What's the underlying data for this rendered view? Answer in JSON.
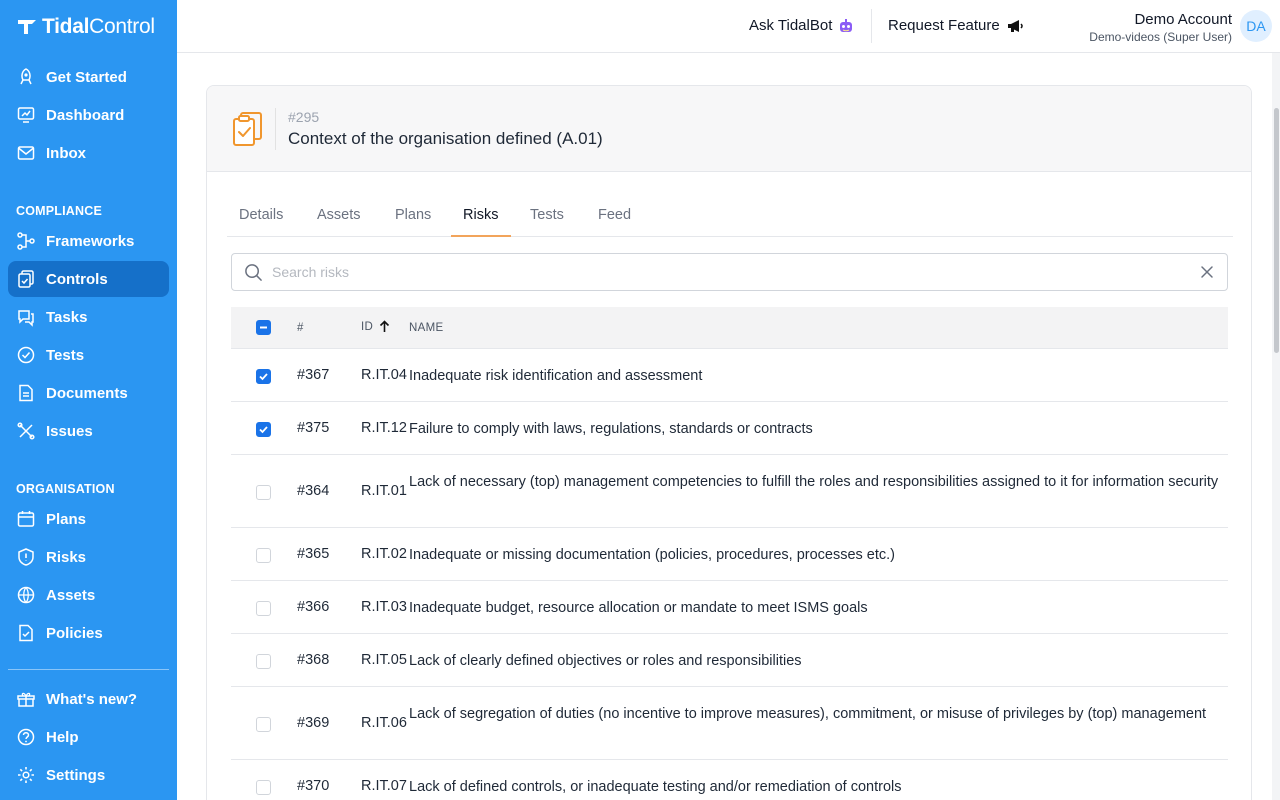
{
  "app": {
    "logo_text_bold": "Tidal",
    "logo_text_light": "Control"
  },
  "sidebar": {
    "top_items": [
      {
        "label": "Get Started",
        "icon": "rocket-icon"
      },
      {
        "label": "Dashboard",
        "icon": "dashboard-icon"
      },
      {
        "label": "Inbox",
        "icon": "inbox-icon"
      }
    ],
    "compliance_title": "COMPLIANCE",
    "compliance_items": [
      {
        "label": "Frameworks",
        "icon": "frameworks-icon"
      },
      {
        "label": "Controls",
        "icon": "controls-icon",
        "active": true
      },
      {
        "label": "Tasks",
        "icon": "tasks-icon"
      },
      {
        "label": "Tests",
        "icon": "tests-icon"
      },
      {
        "label": "Documents",
        "icon": "documents-icon"
      },
      {
        "label": "Issues",
        "icon": "issues-icon"
      }
    ],
    "organisation_title": "ORGANISATION",
    "organisation_items": [
      {
        "label": "Plans",
        "icon": "plans-icon"
      },
      {
        "label": "Risks",
        "icon": "risks-icon"
      },
      {
        "label": "Assets",
        "icon": "assets-icon"
      },
      {
        "label": "Policies",
        "icon": "policies-icon"
      }
    ],
    "bottom_items": [
      {
        "label": "What's new?",
        "icon": "whats-new-icon"
      },
      {
        "label": "Help",
        "icon": "help-icon"
      },
      {
        "label": "Settings",
        "icon": "settings-icon"
      }
    ],
    "bg_color": "#2b96f2",
    "active_color": "#1570c9"
  },
  "topbar": {
    "ask_bot": "Ask TidalBot",
    "request_feature": "Request Feature",
    "user_name": "Demo Account",
    "user_sub": "Demo-videos (Super User)",
    "avatar": "DA"
  },
  "control": {
    "number": "#295",
    "title": "Context of the organisation defined (A.01)"
  },
  "tabs": [
    "Details",
    "Assets",
    "Plans",
    "Risks",
    "Tests",
    "Feed"
  ],
  "active_tab": "Risks",
  "search": {
    "placeholder": "Search risks"
  },
  "table": {
    "headers": {
      "num": "#",
      "id": "ID",
      "name": "NAME"
    },
    "sort": "ID ascending",
    "rows": [
      {
        "num": "#367",
        "id": "R.IT.04",
        "name": "Inadequate risk identification and assessment",
        "checked": true
      },
      {
        "num": "#375",
        "id": "R.IT.12",
        "name": "Failure to comply with laws, regulations, standards or contracts",
        "checked": true
      },
      {
        "num": "#364",
        "id": "R.IT.01",
        "name": "Lack of necessary (top) management competencies to fulfill the roles and responsibilities assigned to it for information security",
        "checked": false
      },
      {
        "num": "#365",
        "id": "R.IT.02",
        "name": "Inadequate or missing documentation (policies, procedures, processes etc.)",
        "checked": false
      },
      {
        "num": "#366",
        "id": "R.IT.03",
        "name": "Inadequate budget, resource allocation or mandate to meet ISMS goals",
        "checked": false
      },
      {
        "num": "#368",
        "id": "R.IT.05",
        "name": "Lack of clearly defined objectives or roles and responsibilities",
        "checked": false
      },
      {
        "num": "#369",
        "id": "R.IT.06",
        "name": "Lack of segregation of duties (no incentive to improve measures), commitment, or misuse of privileges by (top) management",
        "checked": false
      },
      {
        "num": "#370",
        "id": "R.IT.07",
        "name": "Lack of defined controls, or inadequate testing and/or remediation of controls",
        "checked": false
      }
    ]
  }
}
